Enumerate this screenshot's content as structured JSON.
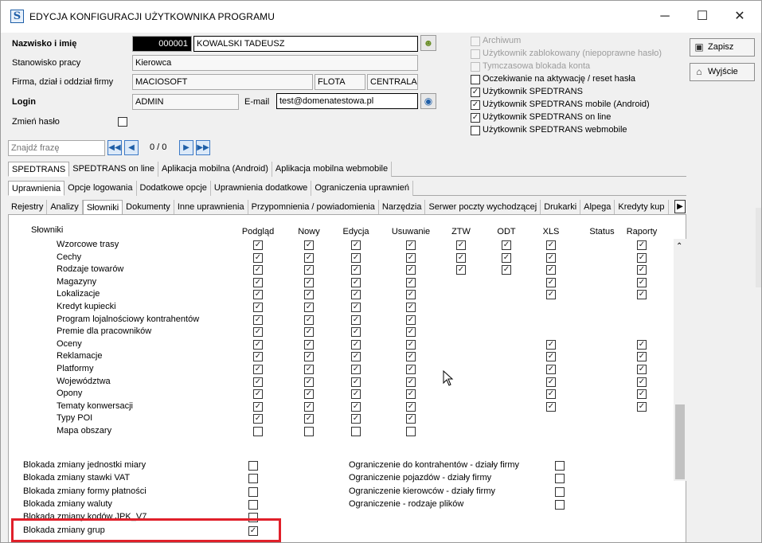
{
  "window": {
    "title": "EDYCJA KONFIGURACJI UŻYTKOWNIKA PROGRAMU",
    "app_icon": "S",
    "controls": [
      "─",
      "☐",
      "✕"
    ]
  },
  "form": {
    "name_label": "Nazwisko i imię",
    "id_value": "000001",
    "name_value": "KOWALSKI TADEUSZ",
    "position_label": "Stanowisko pracy",
    "position_value": "Kierowca",
    "company_label": "Firma, dział i oddział firmy",
    "company_value": "MACIOSOFT",
    "dept_value": "FLOTA",
    "branch_value": "CENTRALA",
    "login_label": "Login",
    "login_value": "ADMIN",
    "email_label": "E-mail",
    "email_value": "test@domenatestowa.pl",
    "change_password_label": "Zmień hasło"
  },
  "options": [
    {
      "label": "Archiwum",
      "checked": false,
      "disabled": true
    },
    {
      "label": "Użytkownik zablokowany (niepoprawne hasło)",
      "checked": false,
      "disabled": true
    },
    {
      "label": "Tymczasowa blokada konta",
      "checked": false,
      "disabled": true
    },
    {
      "label": "Oczekiwanie na aktywację / reset hasła",
      "checked": false,
      "disabled": false
    },
    {
      "label": "Użytkownik SPEDTRANS",
      "checked": true,
      "disabled": false
    },
    {
      "label": "Użytkownik SPEDTRANS mobile (Android)",
      "checked": true,
      "disabled": false
    },
    {
      "label": "Użytkownik SPEDTRANS on line",
      "checked": true,
      "disabled": false
    },
    {
      "label": "Użytkownik SPEDTRANS webmobile",
      "checked": false,
      "disabled": false
    }
  ],
  "buttons": {
    "save": "Zapisz",
    "exit": "Wyjście"
  },
  "search": {
    "placeholder": "Znajdź frazę",
    "counter": "0 / 0"
  },
  "tabs_row1": [
    "SPEDTRANS",
    "SPEDTRANS on line",
    "Aplikacja mobilna (Android)",
    "Aplikacja mobilna webmobile"
  ],
  "tabs_row2": [
    "Uprawnienia",
    "Opcje logowania",
    "Dodatkowe opcje",
    "Uprawnienia dodatkowe",
    "Ograniczenia uprawnień"
  ],
  "tabs_row3": [
    "Rejestry",
    "Analizy",
    "Słowniki",
    "Dokumenty",
    "Inne uprawnienia",
    "Przypomnienia / powiadomienia",
    "Narzędzia",
    "Serwer poczty wychodzącej",
    "Drukarki",
    "Alpega",
    "Kredyty kup"
  ],
  "grid": {
    "section_label": "Słowniki",
    "columns": [
      "Podgląd",
      "Nowy",
      "Edycja",
      "Usuwanie",
      "ZTW",
      "ODT",
      "XLS",
      "Status",
      "Raporty"
    ],
    "rows": [
      {
        "label": "Wzorcowe trasy",
        "v": [
          1,
          1,
          1,
          1,
          1,
          1,
          1,
          0,
          1
        ],
        "show": [
          1,
          1,
          1,
          1,
          1,
          1,
          1,
          0,
          1
        ]
      },
      {
        "label": "Cechy",
        "v": [
          1,
          1,
          1,
          1,
          1,
          1,
          1,
          0,
          1
        ],
        "show": [
          1,
          1,
          1,
          1,
          1,
          1,
          1,
          0,
          1
        ]
      },
      {
        "label": "Rodzaje towarów",
        "v": [
          1,
          1,
          1,
          1,
          1,
          1,
          1,
          0,
          1
        ],
        "show": [
          1,
          1,
          1,
          1,
          1,
          1,
          1,
          0,
          1
        ]
      },
      {
        "label": "Magazyny",
        "v": [
          1,
          1,
          1,
          1,
          0,
          0,
          1,
          0,
          1
        ],
        "show": [
          1,
          1,
          1,
          1,
          0,
          0,
          1,
          0,
          1
        ]
      },
      {
        "label": "Lokalizacje",
        "v": [
          1,
          1,
          1,
          1,
          0,
          0,
          1,
          0,
          1
        ],
        "show": [
          1,
          1,
          1,
          1,
          0,
          0,
          1,
          0,
          1
        ]
      },
      {
        "label": "Kredyt kupiecki",
        "v": [
          1,
          1,
          1,
          1,
          0,
          0,
          0,
          0,
          0
        ],
        "show": [
          1,
          1,
          1,
          1,
          0,
          0,
          0,
          0,
          0
        ]
      },
      {
        "label": "Program lojalnościowy kontrahentów",
        "v": [
          1,
          1,
          1,
          1,
          0,
          0,
          0,
          0,
          0
        ],
        "show": [
          1,
          1,
          1,
          1,
          0,
          0,
          0,
          0,
          0
        ]
      },
      {
        "label": "Premie dla pracowników",
        "v": [
          1,
          1,
          1,
          1,
          0,
          0,
          0,
          0,
          0
        ],
        "show": [
          1,
          1,
          1,
          1,
          0,
          0,
          0,
          0,
          0
        ]
      },
      {
        "label": "Oceny",
        "v": [
          1,
          1,
          1,
          1,
          0,
          0,
          1,
          0,
          1
        ],
        "show": [
          1,
          1,
          1,
          1,
          0,
          0,
          1,
          0,
          1
        ]
      },
      {
        "label": "Reklamacje",
        "v": [
          1,
          1,
          1,
          1,
          0,
          0,
          1,
          0,
          1
        ],
        "show": [
          1,
          1,
          1,
          1,
          0,
          0,
          1,
          0,
          1
        ]
      },
      {
        "label": "Platformy",
        "v": [
          1,
          1,
          1,
          1,
          0,
          0,
          1,
          0,
          1
        ],
        "show": [
          1,
          1,
          1,
          1,
          0,
          0,
          1,
          0,
          1
        ]
      },
      {
        "label": "Województwa",
        "v": [
          1,
          1,
          1,
          1,
          0,
          0,
          1,
          0,
          1
        ],
        "show": [
          1,
          1,
          1,
          1,
          0,
          0,
          1,
          0,
          1
        ]
      },
      {
        "label": "Opony",
        "v": [
          1,
          1,
          1,
          1,
          0,
          0,
          1,
          0,
          1
        ],
        "show": [
          1,
          1,
          1,
          1,
          0,
          0,
          1,
          0,
          1
        ]
      },
      {
        "label": "Tematy konwersacji",
        "v": [
          1,
          1,
          1,
          1,
          0,
          0,
          1,
          0,
          1
        ],
        "show": [
          1,
          1,
          1,
          1,
          0,
          0,
          1,
          0,
          1
        ]
      },
      {
        "label": "Typy POI",
        "v": [
          1,
          1,
          1,
          1,
          0,
          0,
          0,
          0,
          0
        ],
        "show": [
          1,
          1,
          1,
          1,
          0,
          0,
          0,
          0,
          0
        ]
      },
      {
        "label": "Mapa obszary",
        "v": [
          0,
          0,
          0,
          0,
          0,
          0,
          0,
          0,
          0
        ],
        "show": [
          1,
          1,
          1,
          1,
          0,
          0,
          0,
          0,
          0
        ]
      }
    ]
  },
  "blocks_left": [
    {
      "label": "Blokada zmiany jednostki miary",
      "checked": false
    },
    {
      "label": "Blokada zmiany stawki VAT",
      "checked": false
    },
    {
      "label": "Blokada zmiany formy płatności",
      "checked": false
    },
    {
      "label": "Blokada zmiany waluty",
      "checked": false
    },
    {
      "label": "Blokada zmiany kodów JPK_V7",
      "checked": false
    },
    {
      "label": "Blokada zmiany grup",
      "checked": true
    }
  ],
  "blocks_right": [
    {
      "label": "Ograniczenie do kontrahentów - działy firmy",
      "checked": false
    },
    {
      "label": "Ograniczenie pojazdów - działy firmy",
      "checked": false
    },
    {
      "label": "Ograniczenie kierowców - działy firmy",
      "checked": false
    },
    {
      "label": "Ograniczenie - rodzaje plików",
      "checked": false
    }
  ],
  "colors": {
    "highlight": "#e0202a",
    "nav_blue": "#1f5fa8"
  }
}
